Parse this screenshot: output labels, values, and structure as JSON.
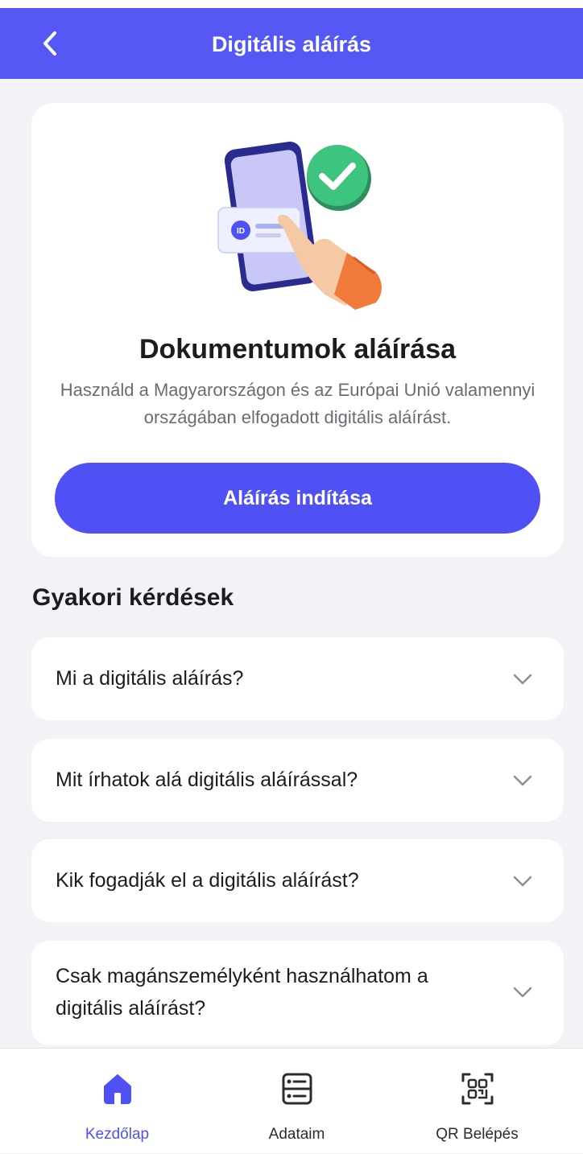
{
  "header": {
    "title": "Digitális aláírás"
  },
  "hero": {
    "title": "Dokumentumok aláírása",
    "description": "Használd a Magyarországon és az Európai Unió valamennyi országában elfogadott digitális aláírást.",
    "button_label": "Aláírás indítása"
  },
  "faq": {
    "heading": "Gyakori kérdések",
    "items": [
      {
        "question": "Mi a digitális aláírás?"
      },
      {
        "question": "Mit írhatok alá digitális aláírással?"
      },
      {
        "question": "Kik fogadják el a digitális aláírást?"
      },
      {
        "question": "Csak magánszemélyként használhatom a digitális aláírást?"
      }
    ]
  },
  "tabbar": {
    "items": [
      {
        "label": "Kezdőlap",
        "icon": "home-icon",
        "active": true
      },
      {
        "label": "Adataim",
        "icon": "id-card-icon",
        "active": false
      },
      {
        "label": "QR Belépés",
        "icon": "qr-scan-icon",
        "active": false
      }
    ]
  },
  "colors": {
    "accent": "#4f51f5",
    "header_bg": "#5558f5",
    "background": "#f2f2f7",
    "success": "#3dc47e"
  }
}
